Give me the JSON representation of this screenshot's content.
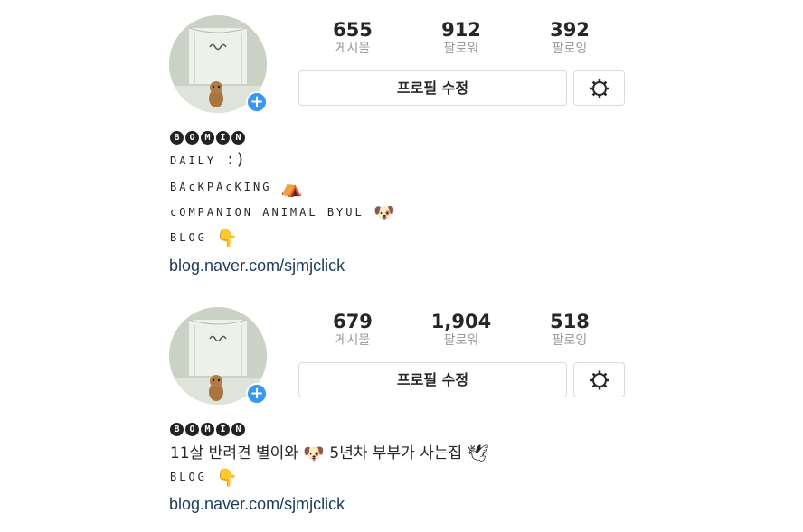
{
  "profiles": [
    {
      "stats": [
        {
          "value": "655",
          "label": "게시물"
        },
        {
          "value": "912",
          "label": "팔로워"
        },
        {
          "value": "392",
          "label": "팔로잉"
        }
      ],
      "edit_label": "프로필 수정",
      "username_letters": [
        "B",
        "O",
        "M",
        "I",
        "N"
      ],
      "bio": {
        "line1": "DAILY",
        "line1_suffix": ":)",
        "line2": "BAcKPAcKING",
        "line2_emoji": "⛺",
        "line3": "cOMPANION ANIMAL BYUL",
        "line3_emoji": "🐶",
        "line4": "BLOG",
        "line4_emoji": "👇"
      },
      "link": "blog.naver.com/sjmjclick"
    },
    {
      "stats": [
        {
          "value": "679",
          "label": "게시물"
        },
        {
          "value": "1,904",
          "label": "팔로워"
        },
        {
          "value": "518",
          "label": "팔로잉"
        }
      ],
      "edit_label": "프로필 수정",
      "username_letters": [
        "B",
        "O",
        "M",
        "I",
        "N"
      ],
      "bio": {
        "line1_a": "11살 반려견 별이와",
        "line1_emoji": "🐶",
        "line1_b": "5년차 부부가 사는집",
        "line1_emoji2": "🕊",
        "line2": "BLOG",
        "line2_emoji": "👇"
      },
      "link": "blog.naver.com/sjmjclick"
    }
  ],
  "colors": {
    "accent_blue": "#3897f0",
    "link": "#1c3b5a",
    "muted": "#999999",
    "border": "#dbdbdb"
  },
  "icons": {
    "add_badge": "plus-icon",
    "settings": "gear-icon"
  }
}
